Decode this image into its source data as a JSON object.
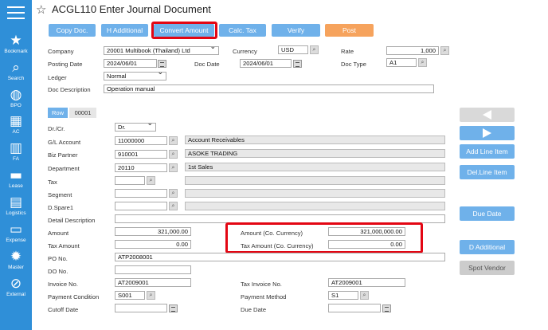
{
  "window_title": "ACGL110 Enter Journal Document",
  "sidebar": [
    {
      "icon": "★",
      "label": "Bookmark"
    },
    {
      "icon": "⌕",
      "label": "Search"
    },
    {
      "icon": "◍",
      "label": "BPO"
    },
    {
      "icon": "▦",
      "label": "AC"
    },
    {
      "icon": "▥",
      "label": "FA"
    },
    {
      "icon": "▬",
      "label": "Lease"
    },
    {
      "icon": "▤",
      "label": "Logistics"
    },
    {
      "icon": "▭",
      "label": "Expense"
    },
    {
      "icon": "✹",
      "label": "Master"
    },
    {
      "icon": "⊘",
      "label": "External"
    }
  ],
  "toolbar": {
    "copy_doc": "Copy Doc.",
    "h_additional": "H Additional",
    "convert_amount": "Convert Amount",
    "calc_tax": "Calc. Tax",
    "verify": "Verify",
    "post": "Post"
  },
  "header": {
    "company_label": "Company",
    "company_value": "20001 Multibook (Thailand) Ltd",
    "currency_label": "Currency",
    "currency_value": "USD",
    "rate_label": "Rate",
    "rate_value": "1,000",
    "posting_date_label": "Posting Date",
    "posting_date_value": "2024/06/01",
    "doc_date_label": "Doc Date",
    "doc_date_value": "2024/06/01",
    "doc_type_label": "Doc Type",
    "doc_type_value": "A1",
    "ledger_label": "Ledger",
    "ledger_value": "Normal",
    "doc_desc_label": "Doc Description",
    "doc_desc_value": "Operation manual"
  },
  "tabs": {
    "row": "Row",
    "row_no": "00001"
  },
  "line": {
    "drcr_label": "Dr./Cr.",
    "drcr_value": "Dr.",
    "gl_label": "G/L Account",
    "gl_value": "11000000",
    "gl_name": "Account Receivables",
    "bp_label": "Biz Partner",
    "bp_value": "910001",
    "bp_name": "ASOKE TRADING",
    "dept_label": "Department",
    "dept_value": "20110",
    "dept_name": "1st Sales",
    "tax_label": "Tax",
    "segment_label": "Segment",
    "spare_label": "D.Spare1",
    "detail_label": "Detail Description",
    "amount_label": "Amount",
    "amount_value": "321,000.00",
    "amount_co_label": "Amount (Co. Currency)",
    "amount_co_value": "321,000,000.00",
    "tax_amount_label": "Tax Amount",
    "tax_amount_value": "0.00",
    "tax_amount_co_label": "Tax Amount (Co. Currency)",
    "tax_amount_co_value": "0.00",
    "po_label": "PO No.",
    "po_value": "ATP2008001",
    "do_label": "DO No.",
    "invoice_label": "Invoice No.",
    "invoice_value": "AT2009001",
    "tax_invoice_label": "Tax Invoice No.",
    "tax_invoice_value": "AT2009001",
    "pay_cond_label": "Payment Condition",
    "pay_cond_value": "S001",
    "pay_method_label": "Payment Method",
    "pay_method_value": "S1",
    "cutoff_label": "Cutoff Date",
    "due_label": "Due Date"
  },
  "right_buttons": {
    "add_line": "Add Line Item",
    "del_line": "Del.Line Item",
    "due_date": "Due Date",
    "d_additional": "D Additional",
    "spot_vendor": "Spot Vendor"
  }
}
